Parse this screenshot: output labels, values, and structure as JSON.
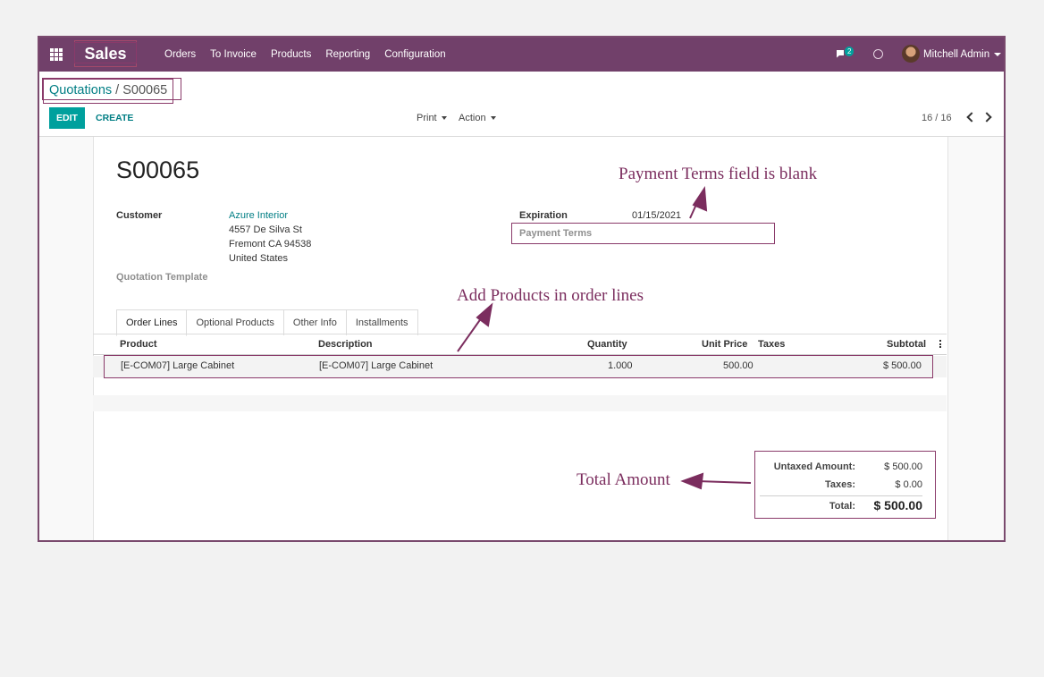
{
  "navbar": {
    "app_name": "Sales",
    "menu": [
      "Orders",
      "To Invoice",
      "Products",
      "Reporting",
      "Configuration"
    ],
    "chat_count": "2",
    "user_name": "Mitchell Admin"
  },
  "breadcrumb": {
    "parent": "Quotations",
    "separator": "/",
    "current": "S00065"
  },
  "toolbar": {
    "edit_label": "EDIT",
    "create_label": "CREATE",
    "print_label": "Print",
    "action_label": "Action",
    "pager_value": "16 / 16"
  },
  "form": {
    "name": "S00065",
    "customer_label": "Customer",
    "customer_name": "Azure Interior",
    "address_line1": "4557 De Silva St",
    "address_line2": "Fremont CA 94538",
    "address_line3": "United States",
    "template_label": "Quotation Template",
    "expiration_label": "Expiration",
    "expiration_value": "01/15/2021",
    "payment_terms_label": "Payment Terms",
    "payment_terms_value": ""
  },
  "tabs": [
    "Order Lines",
    "Optional Products",
    "Other Info",
    "Installments"
  ],
  "order_lines": {
    "columns": [
      "Product",
      "Description",
      "Quantity",
      "Unit Price",
      "Taxes",
      "Subtotal"
    ],
    "rows": [
      {
        "product": "[E-COM07] Large Cabinet",
        "description": "[E-COM07] Large Cabinet",
        "quantity": "1.000",
        "unit_price": "500.00",
        "taxes": "",
        "subtotal": "$ 500.00"
      }
    ]
  },
  "totals": {
    "untaxed_label": "Untaxed Amount:",
    "untaxed_value": "$ 500.00",
    "taxes_label": "Taxes:",
    "taxes_value": "$ 0.00",
    "total_label": "Total:",
    "total_value": "$ 500.00"
  },
  "annotations": {
    "payment_terms": "Payment Terms field is blank",
    "order_lines": "Add Products in order lines",
    "total": "Total Amount",
    "color": "#7b2d5e"
  },
  "colors": {
    "navbar": "#71406a",
    "primary_button": "#00a09d",
    "link": "#017e84"
  }
}
